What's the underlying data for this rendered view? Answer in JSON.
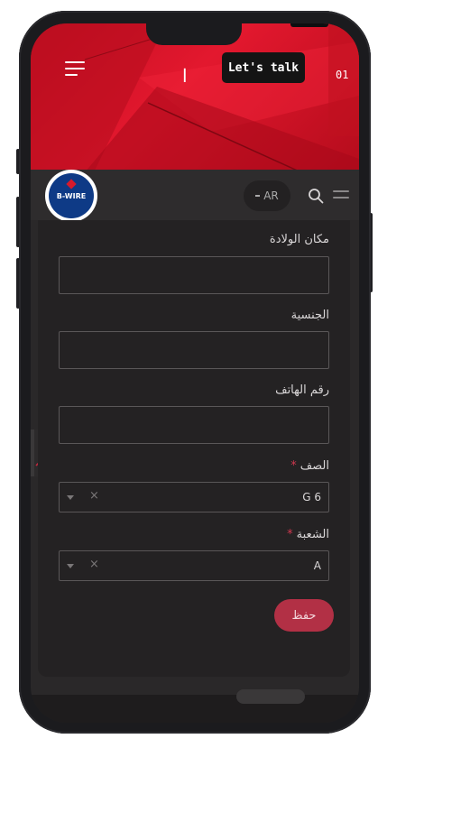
{
  "hero": {
    "decor_char": "ا",
    "cta_label": "Let's talk",
    "slide_number": "01",
    "accent_color": "#e3182e"
  },
  "header": {
    "logo_text": "B-WIRE",
    "lang_label": "AR",
    "search_icon": "search-icon",
    "menu_icon": "menu-icon"
  },
  "form": {
    "birthplace_label": "مكان الولادة",
    "birthplace_value": "",
    "nationality_label": "الجنسية",
    "nationality_value": "",
    "phone_label": "رقم الهاتف",
    "phone_value": "",
    "grade_label": "الصف",
    "grade_value": "G 6",
    "section_label": "الشعبة",
    "section_value": "A",
    "required_mark": "*",
    "clear_glyph": "×",
    "save_label": "حفظ",
    "save_color": "#b23045"
  }
}
